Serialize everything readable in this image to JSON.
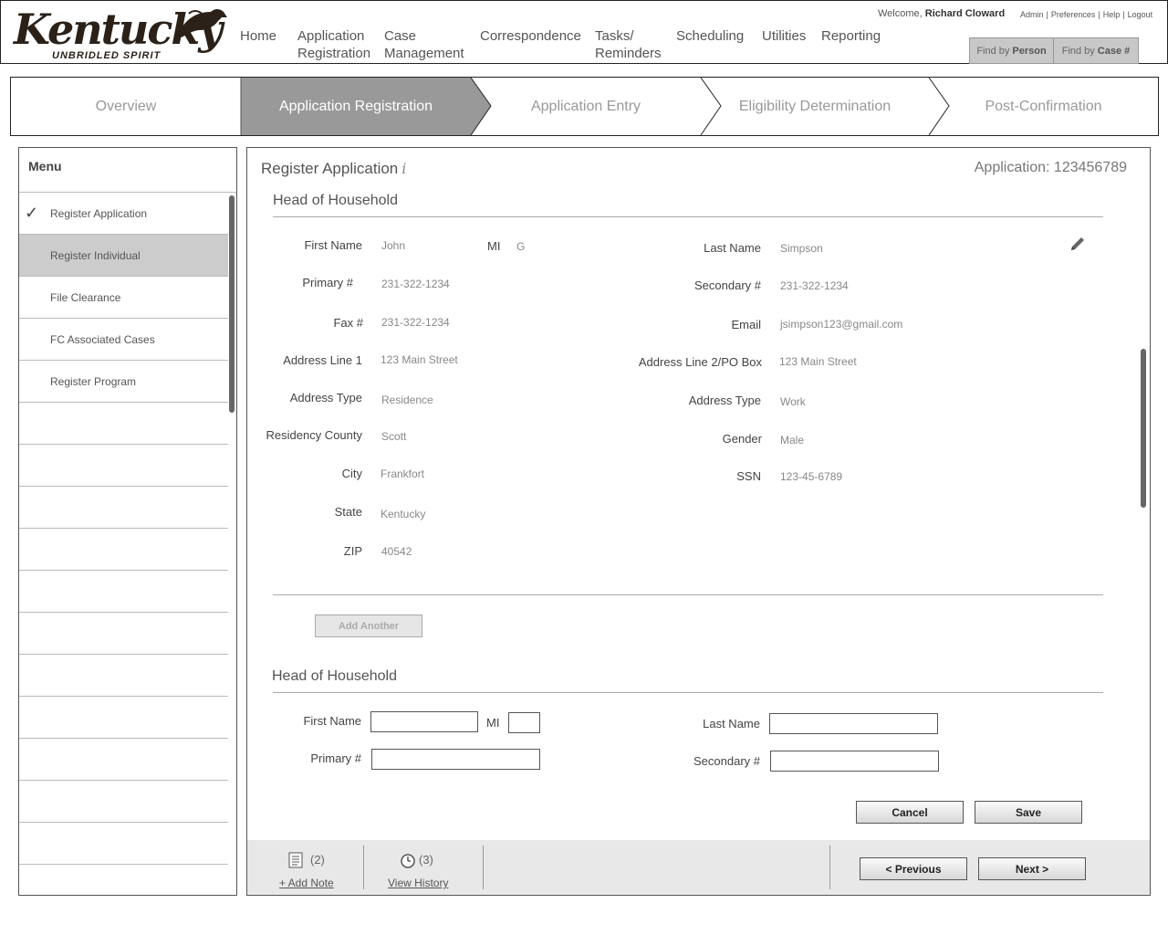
{
  "header": {
    "logo_text": "Kentucky",
    "logo_tagline": "UNBRIDLED SPIRIT",
    "nav": [
      {
        "line1": "",
        "line2": "Home"
      },
      {
        "line1": "Application",
        "line2": "Registration"
      },
      {
        "line1": "Case",
        "line2": "Management"
      },
      {
        "line1": "",
        "line2": "Correspondence"
      },
      {
        "line1": "Tasks/",
        "line2": "Reminders"
      },
      {
        "line1": "",
        "line2": "Scheduling"
      },
      {
        "line1": "",
        "line2": "Utilities"
      },
      {
        "line1": "",
        "line2": "Reporting"
      }
    ],
    "welcome_prefix": "Welcome,",
    "user_name": "Richard Cloward",
    "links": [
      "Admin",
      "Preferences",
      "Help",
      "Logout"
    ],
    "find_by": "Find by",
    "find_person": "Person",
    "find_case": "Case #"
  },
  "workflow": {
    "steps": [
      "Overview",
      "Application Registration",
      "Application Entry",
      "Eligibility Determination",
      "Post-Confirmation"
    ],
    "active": "Application Registration"
  },
  "sidebar": {
    "title": "Menu",
    "items": [
      {
        "label": "Register Application",
        "checked": true
      },
      {
        "label": "Register Individual",
        "selected": true
      },
      {
        "label": "File Clearance"
      },
      {
        "label": "FC Associated Cases"
      },
      {
        "label": "Register Program"
      }
    ]
  },
  "main": {
    "title": "Register Application",
    "info_glyph": "i",
    "app_number": "Application: 123456789",
    "section1": {
      "heading": "Head of Household",
      "first_name_label": "First Name",
      "first_name": "John",
      "mi_label": "MI",
      "mi": "G",
      "last_name_label": "Last Name",
      "last_name": "Simpson",
      "primary_label": "Primary #",
      "primary": "231-322-1234",
      "secondary_label": "Secondary #",
      "secondary": "231-322-1234",
      "fax_label": "Fax #",
      "fax": "231-322-1234",
      "email_label": "Email",
      "email": "jsimpson123@gmail.com",
      "addr1_label": "Address Line 1",
      "addr1": "123 Main Street",
      "addr2_label": "Address Line 2/PO Box",
      "addr2": "123 Main Street",
      "addr_type_label": "Address Type",
      "addr_type": "Residence",
      "addr_type2_label": "Address Type",
      "addr_type2": "Work",
      "county_label": "Residency County",
      "county": "Scott",
      "gender_label": "Gender",
      "gender": "Male",
      "city_label": "City",
      "city": "Frankfort",
      "ssn_label": "SSN",
      "ssn": "123-45-6789",
      "state_label": "State",
      "state": "Kentucky",
      "zip_label": "ZIP",
      "zip": "40542"
    },
    "add_another": "Add Another",
    "section2": {
      "heading": "Head of Household",
      "first_name_label": "First Name",
      "first_name": "",
      "mi_label": "MI",
      "mi": "",
      "last_name_label": "Last Name",
      "last_name": "",
      "primary_label": "Primary #",
      "primary": "",
      "secondary_label": "Secondary #",
      "secondary": ""
    },
    "cancel": "Cancel",
    "save": "Save",
    "footer": {
      "notes_count": "(2)",
      "add_note": "+ Add Note",
      "history_count": "(3)",
      "view_history": "View History",
      "previous": "< Previous",
      "next": "Next >"
    }
  }
}
